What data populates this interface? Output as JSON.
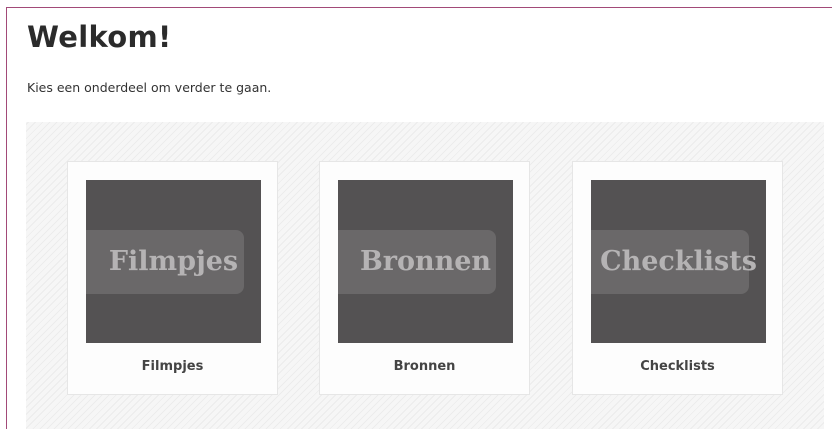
{
  "page": {
    "title": "Welkom!",
    "intro": "Kies een onderdeel om verder te gaan."
  },
  "tiles": [
    {
      "image_text": "Filmpjes",
      "caption": "Filmpjes"
    },
    {
      "image_text": "Bronnen",
      "caption": "Bronnen"
    },
    {
      "image_text": "Checklists",
      "caption": "Checklists"
    }
  ],
  "colors": {
    "frame_accent": "#a24a78",
    "tile_image_bg": "#545253",
    "tile_image_text": "#b5b3b4"
  }
}
